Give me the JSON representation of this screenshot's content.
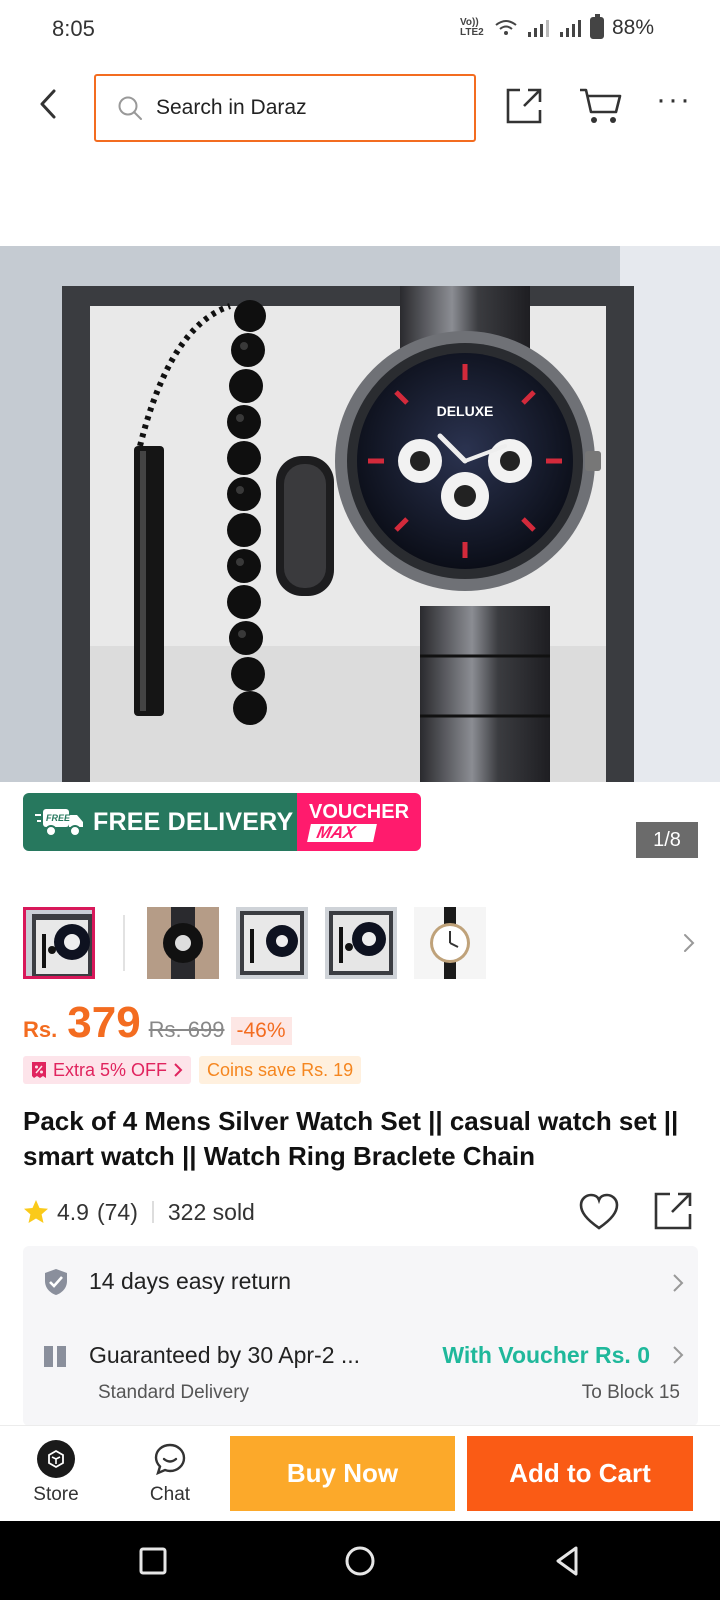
{
  "status_bar": {
    "time": "8:05",
    "network": "Vo)) LTE2",
    "battery": "88%"
  },
  "header": {
    "search_placeholder": "Search in Daraz",
    "icons": [
      "back-arrow-icon",
      "search-icon",
      "share-icon",
      "cart-icon",
      "more-icon"
    ]
  },
  "gallery": {
    "counter": "1/8",
    "image_watch_brand": "DELUXE",
    "thumbnails": [
      "thumb-1",
      "thumb-2",
      "thumb-3",
      "thumb-4",
      "thumb-5"
    ]
  },
  "promo": {
    "free_badge": "FREE",
    "delivery_label": "FREE DELIVERY",
    "voucher_top": "VOUCHER",
    "voucher_bottom": "MAX"
  },
  "price": {
    "currency": "Rs.",
    "current": "379",
    "original": "Rs. 699",
    "discount": "-46%"
  },
  "tags": {
    "extra_off": "Extra 5% OFF",
    "coins": "Coins save Rs. 19"
  },
  "product": {
    "title": "Pack of 4 Mens Silver Watch Set || casual watch set || smart watch || Watch Ring Braclete Chain",
    "rating": "4.9",
    "reviews": "(74)",
    "sold": "322 sold"
  },
  "service": {
    "return_policy": "14 days easy return",
    "delivery_guarantee": "Guaranteed by 30 Apr-2 ...",
    "voucher_offer": "With Voucher Rs. 0",
    "delivery_type": "Standard Delivery",
    "destination": "To Block 15"
  },
  "bottom_bar": {
    "store_label": "Store",
    "chat_label": "Chat",
    "buy_now_label": "Buy Now",
    "add_to_cart_label": "Add to Cart"
  },
  "colors": {
    "brand_orange": "#f36c20",
    "buy_now": "#fca92a",
    "add_to_cart": "#fa5b15",
    "free_delivery_green": "#27785e",
    "voucher_pink": "#ff1b6d",
    "voucher_teal": "#1fb89b"
  }
}
